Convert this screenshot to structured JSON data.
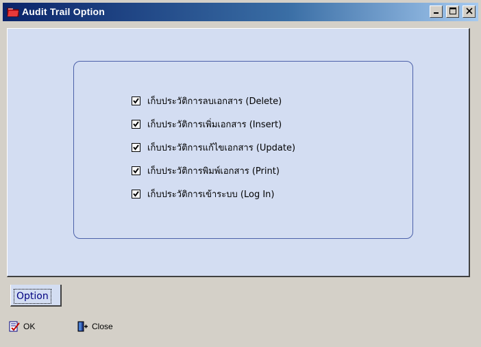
{
  "window": {
    "title": "Audit Trail Option",
    "icons": {
      "app": "red-folder-icon",
      "minimize": "minimize-icon",
      "maximize": "maximize-icon",
      "close": "close-icon"
    }
  },
  "options": [
    {
      "label": "เก็บประวัติการลบเอกสาร (Delete)",
      "checked": true
    },
    {
      "label": "เก็บประวัติการเพิ่มเอกสาร (Insert)",
      "checked": true
    },
    {
      "label": "เก็บประวัติการแก้ไขเอกสาร (Update)",
      "checked": true
    },
    {
      "label": "เก็บประวัติการพิมพ์เอกสาร (Print)",
      "checked": true
    },
    {
      "label": "เก็บประวัติการเข้าระบบ (Log In)",
      "checked": true
    }
  ],
  "tabs": [
    {
      "label": "Option"
    }
  ],
  "toolbar": {
    "ok_label": "OK",
    "close_label": "Close",
    "ok_icon": "check-document-icon",
    "close_icon": "exit-door-icon"
  },
  "colors": {
    "panel": "#d3ddf2",
    "title_start": "#0a246a",
    "title_end": "#a6caf0",
    "tab_text": "#000080"
  }
}
